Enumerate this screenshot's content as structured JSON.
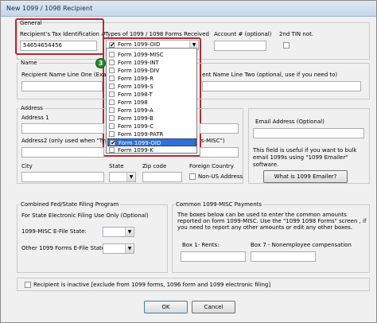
{
  "window": {
    "title": "New 1099 / 1098 Recipient"
  },
  "general": {
    "group_label": "General",
    "tin_label": "Recipient's Tax Identification #",
    "tin_value": "54654654456",
    "types_label": "Types of 1099 / 1098 Forms Received",
    "selected_form": "Form 1099-OID",
    "account_label": "Account # (optional)",
    "second_tin_label": "2nd TIN not."
  },
  "form_list": {
    "items": [
      {
        "label": "Form 1099-MISC",
        "checked": false,
        "selected": false
      },
      {
        "label": "Form 1099-INT",
        "checked": false,
        "selected": false
      },
      {
        "label": "Form 1099-DIV",
        "checked": false,
        "selected": false
      },
      {
        "label": "Form 1099-R",
        "checked": false,
        "selected": false
      },
      {
        "label": "Form 1099-S",
        "checked": false,
        "selected": false
      },
      {
        "label": "Form 1098-T",
        "checked": false,
        "selected": false
      },
      {
        "label": "Form 1098",
        "checked": false,
        "selected": false
      },
      {
        "label": "Form 1099-A",
        "checked": false,
        "selected": false
      },
      {
        "label": "Form 1099-B",
        "checked": false,
        "selected": false
      },
      {
        "label": "Form 1099-C",
        "checked": false,
        "selected": false
      },
      {
        "label": "Form 1099-PATR",
        "checked": false,
        "selected": false
      },
      {
        "label": "Form 1099-OID",
        "checked": true,
        "selected": true
      },
      {
        "label": "Form 1099-K",
        "checked": false,
        "selected": false
      }
    ],
    "step_badge": "3"
  },
  "name": {
    "group_label": "Name",
    "line_one_label": "Recipient Name Line One (Exampl",
    "line_two_label": "ent Name Line Two (optional, use if you need to)"
  },
  "address": {
    "group_label": "Address",
    "address1_label": "Address 1",
    "address2_label": "Address2 (only used when \"Types",
    "address2_suffix": "s-MISC\")",
    "city_label": "City",
    "state_label": "State",
    "zip_label": "Zip code",
    "foreign_label": "Foreign Country",
    "non_us_label": "Non-US Address"
  },
  "email": {
    "label": "Email Address (Optional)",
    "help_text": "This field is useful if you want to bulk email 1099s using \"1099 Emailer\" software.",
    "button": "What is 1099 Emailer?"
  },
  "state_program": {
    "group_label": "Combined Fed/State Filing Program",
    "sub_label": "For State Electronic Filing Use Only (Optional)",
    "misc_state_label": "1099-MISC E-File State:",
    "other_state_label": "Other 1099 Forms E-File State:"
  },
  "misc_payments": {
    "group_label": "Common 1099-MISC Payments",
    "description": "The boxes below can be used to enter the common amounts reported on form 1099-MISC. Use the \"1099  1098 Forms\" screen , if you need to report any other amounts or edit any other boxes.",
    "box1_label": "Box 1- Rents:",
    "box7_label": "Box 7 - Nonemployee compensation"
  },
  "inactive": {
    "label": "Recipient is inactive [exclude from 1099 forms, 1096 form and 1099 electronic filing]"
  },
  "buttons": {
    "ok": "OK",
    "cancel": "Cancel"
  }
}
